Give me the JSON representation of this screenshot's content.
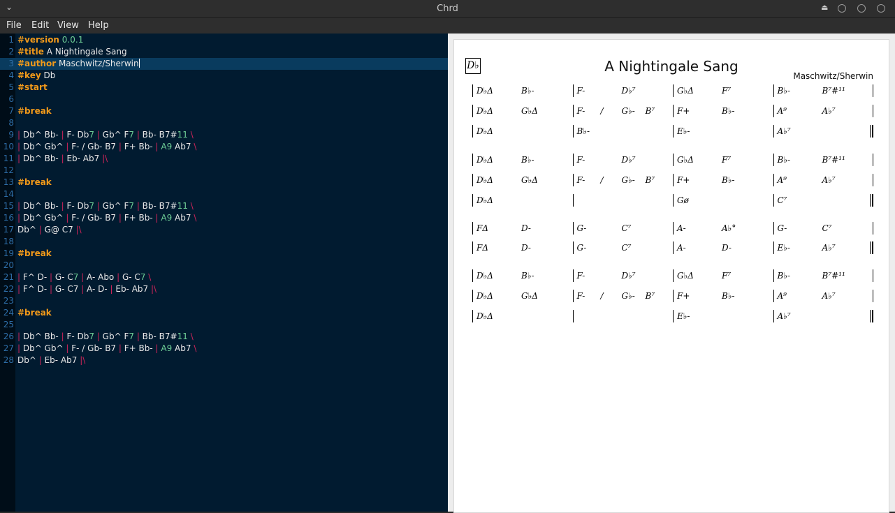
{
  "window": {
    "title": "Chrd",
    "menu": [
      "File",
      "Edit",
      "View",
      "Help"
    ]
  },
  "editor": {
    "lines": [
      {
        "n": "1",
        "tokens": [
          [
            "kw",
            "#version"
          ],
          [
            "val",
            " 0.0.1"
          ]
        ]
      },
      {
        "n": "2",
        "tokens": [
          [
            "kw",
            "#title"
          ],
          [
            "ch",
            " A Nightingale Sang"
          ]
        ]
      },
      {
        "n": "3",
        "tokens": [
          [
            "kw",
            "#author"
          ],
          [
            "ch",
            " Maschwitz/Sherwin"
          ]
        ],
        "current": true
      },
      {
        "n": "4",
        "tokens": [
          [
            "kw",
            "#key"
          ],
          [
            "ch",
            " Db"
          ]
        ]
      },
      {
        "n": "5",
        "tokens": [
          [
            "kw",
            "#start"
          ]
        ]
      },
      {
        "n": "6",
        "tokens": []
      },
      {
        "n": "7",
        "tokens": [
          [
            "kw",
            "#break"
          ]
        ]
      },
      {
        "n": "8",
        "tokens": []
      },
      {
        "n": "9",
        "tokens": [
          [
            "bar",
            "| "
          ],
          [
            "ch",
            "Db^ Bb- "
          ],
          [
            "bar",
            "| "
          ],
          [
            "ch",
            "F- Db"
          ],
          [
            "num",
            "7"
          ],
          [
            "bar",
            " | "
          ],
          [
            "ch",
            "Gb^ F"
          ],
          [
            "num",
            "7"
          ],
          [
            "bar",
            " | "
          ],
          [
            "ch",
            "Bb- B7#"
          ],
          [
            "num",
            "11"
          ],
          [
            "bar",
            " \\"
          ]
        ]
      },
      {
        "n": "10",
        "tokens": [
          [
            "bar",
            "| "
          ],
          [
            "ch",
            "Db^ Gb^ "
          ],
          [
            "bar",
            "| "
          ],
          [
            "ch",
            "F- / Gb- B7 "
          ],
          [
            "bar",
            "| "
          ],
          [
            "ch",
            "F+ Bb- "
          ],
          [
            "bar",
            "| "
          ],
          [
            "num",
            "A9"
          ],
          [
            "ch",
            " Ab7 "
          ],
          [
            "bar",
            "\\"
          ]
        ]
      },
      {
        "n": "11",
        "tokens": [
          [
            "bar",
            "| "
          ],
          [
            "ch",
            "Db^ Bb- "
          ],
          [
            "bar",
            "| "
          ],
          [
            "ch",
            "Eb- Ab7 "
          ],
          [
            "bar",
            "|\\"
          ]
        ]
      },
      {
        "n": "12",
        "tokens": []
      },
      {
        "n": "13",
        "tokens": [
          [
            "kw",
            "#break"
          ]
        ]
      },
      {
        "n": "14",
        "tokens": []
      },
      {
        "n": "15",
        "tokens": [
          [
            "bar",
            "| "
          ],
          [
            "ch",
            "Db^ Bb- "
          ],
          [
            "bar",
            "| "
          ],
          [
            "ch",
            "F- Db"
          ],
          [
            "num",
            "7"
          ],
          [
            "bar",
            " | "
          ],
          [
            "ch",
            "Gb^ F"
          ],
          [
            "num",
            "7"
          ],
          [
            "bar",
            " | "
          ],
          [
            "ch",
            "Bb- B7#"
          ],
          [
            "num",
            "11"
          ],
          [
            "bar",
            " \\"
          ]
        ]
      },
      {
        "n": "16",
        "tokens": [
          [
            "bar",
            "| "
          ],
          [
            "ch",
            "Db^ Gb^ "
          ],
          [
            "bar",
            "| "
          ],
          [
            "ch",
            "F- / Gb- B7 "
          ],
          [
            "bar",
            "| "
          ],
          [
            "ch",
            "F+ Bb- "
          ],
          [
            "bar",
            "| "
          ],
          [
            "num",
            "A9"
          ],
          [
            "ch",
            " Ab7 "
          ],
          [
            "bar",
            "\\"
          ]
        ]
      },
      {
        "n": "17",
        "tokens": [
          [
            "ch",
            "Db^ "
          ],
          [
            "bar",
            "| "
          ],
          [
            "ch",
            "G@ C7 "
          ],
          [
            "bar",
            "|\\"
          ]
        ]
      },
      {
        "n": "18",
        "tokens": []
      },
      {
        "n": "19",
        "tokens": [
          [
            "kw",
            "#break"
          ]
        ]
      },
      {
        "n": "20",
        "tokens": []
      },
      {
        "n": "21",
        "tokens": [
          [
            "bar",
            "| "
          ],
          [
            "ch",
            "F^ D- "
          ],
          [
            "bar",
            "| "
          ],
          [
            "ch",
            "G- C"
          ],
          [
            "num",
            "7"
          ],
          [
            "bar",
            " | "
          ],
          [
            "ch",
            "A- Abo "
          ],
          [
            "bar",
            "| "
          ],
          [
            "ch",
            "G- C"
          ],
          [
            "num",
            "7"
          ],
          [
            "bar",
            " \\"
          ]
        ]
      },
      {
        "n": "22",
        "tokens": [
          [
            "bar",
            "| "
          ],
          [
            "ch",
            "F^ D- "
          ],
          [
            "bar",
            "| "
          ],
          [
            "ch",
            "G- C7 "
          ],
          [
            "bar",
            "| "
          ],
          [
            "ch",
            "A- D- "
          ],
          [
            "bar",
            "| "
          ],
          [
            "ch",
            "Eb- Ab7 "
          ],
          [
            "bar",
            "|\\"
          ]
        ]
      },
      {
        "n": "23",
        "tokens": []
      },
      {
        "n": "24",
        "tokens": [
          [
            "kw",
            "#break"
          ]
        ]
      },
      {
        "n": "25",
        "tokens": []
      },
      {
        "n": "26",
        "tokens": [
          [
            "bar",
            "| "
          ],
          [
            "ch",
            "Db^ Bb- "
          ],
          [
            "bar",
            "| "
          ],
          [
            "ch",
            "F- Db"
          ],
          [
            "num",
            "7"
          ],
          [
            "bar",
            " | "
          ],
          [
            "ch",
            "Gb^ F"
          ],
          [
            "num",
            "7"
          ],
          [
            "bar",
            " | "
          ],
          [
            "ch",
            "Bb- B7#"
          ],
          [
            "num",
            "11"
          ],
          [
            "bar",
            " \\"
          ]
        ]
      },
      {
        "n": "27",
        "tokens": [
          [
            "bar",
            "| "
          ],
          [
            "ch",
            "Db^ Gb^ "
          ],
          [
            "bar",
            "| "
          ],
          [
            "ch",
            "F- / Gb- B7 "
          ],
          [
            "bar",
            "| "
          ],
          [
            "ch",
            "F+ Bb- "
          ],
          [
            "bar",
            "| "
          ],
          [
            "num",
            "A9"
          ],
          [
            "ch",
            " Ab7 "
          ],
          [
            "bar",
            "\\"
          ]
        ]
      },
      {
        "n": "28",
        "tokens": [
          [
            "ch",
            "Db^ "
          ],
          [
            "bar",
            "| "
          ],
          [
            "ch",
            "Eb- Ab7 "
          ],
          [
            "bar",
            "|\\"
          ]
        ]
      }
    ]
  },
  "preview": {
    "key": "D♭",
    "title": "A Nightingale Sang",
    "author": "Maschwitz/Sherwin",
    "rows": [
      [
        [
          "D♭Δ",
          "B♭-"
        ],
        [
          "F-",
          "D♭⁷"
        ],
        [
          "G♭Δ",
          "F⁷"
        ],
        [
          "B♭-",
          "B⁷#¹¹"
        ]
      ],
      [
        [
          "D♭Δ",
          "G♭Δ"
        ],
        [
          "F-",
          "/",
          "G♭-",
          "B⁷"
        ],
        [
          "F+",
          "B♭-"
        ],
        [
          "A⁹",
          "A♭⁷"
        ]
      ],
      [
        [
          "D♭Δ"
        ],
        [
          "B♭-"
        ],
        [
          "E♭-"
        ],
        [
          "A♭⁷"
        ]
      ],
      [
        [
          "D♭Δ",
          "B♭-"
        ],
        [
          "F-",
          "D♭⁷"
        ],
        [
          "G♭Δ",
          "F⁷"
        ],
        [
          "B♭-",
          "B⁷#¹¹"
        ]
      ],
      [
        [
          "D♭Δ",
          "G♭Δ"
        ],
        [
          "F-",
          "/",
          "G♭-",
          "B⁷"
        ],
        [
          "F+",
          "B♭-"
        ],
        [
          "A⁹",
          "A♭⁷"
        ]
      ],
      [
        [
          "D♭Δ"
        ],
        [],
        [
          "Gø"
        ],
        [
          "C⁷"
        ]
      ],
      [
        [
          "FΔ",
          "D-"
        ],
        [
          "G-",
          "C⁷"
        ],
        [
          "A-",
          "A♭°"
        ],
        [
          "G-",
          "C⁷"
        ]
      ],
      [
        [
          "FΔ",
          "D-"
        ],
        [
          "G-",
          "C⁷"
        ],
        [
          "A-",
          "D-"
        ],
        [
          "E♭-",
          "A♭⁷"
        ]
      ],
      [
        [
          "D♭Δ",
          "B♭-"
        ],
        [
          "F-",
          "D♭⁷"
        ],
        [
          "G♭Δ",
          "F⁷"
        ],
        [
          "B♭-",
          "B⁷#¹¹"
        ]
      ],
      [
        [
          "D♭Δ",
          "G♭Δ"
        ],
        [
          "F-",
          "/",
          "G♭-",
          "B⁷"
        ],
        [
          "F+",
          "B♭-"
        ],
        [
          "A⁹",
          "A♭⁷"
        ]
      ],
      [
        [
          "D♭Δ"
        ],
        [],
        [
          "E♭-"
        ],
        [
          "A♭⁷"
        ]
      ]
    ],
    "final_rows": [
      2,
      5,
      7,
      10
    ]
  }
}
